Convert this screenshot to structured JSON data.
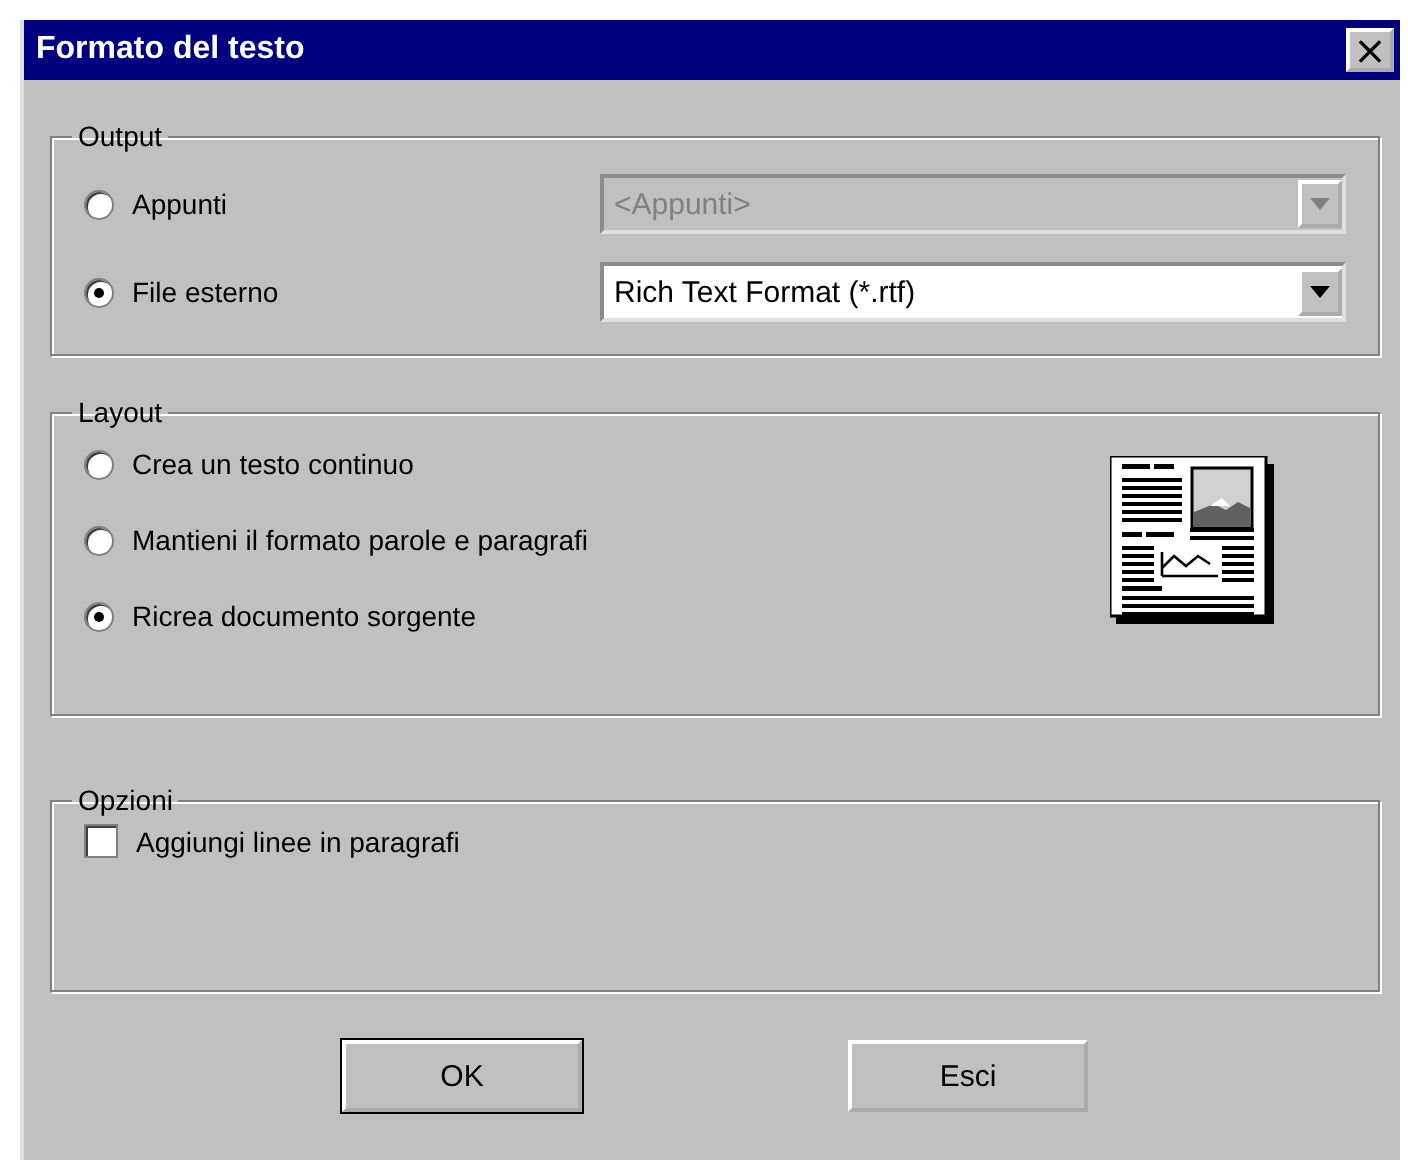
{
  "window": {
    "title": "Formato del testo",
    "close": "×"
  },
  "output": {
    "title": "Output",
    "options": [
      {
        "label": "Appunti",
        "selected": false,
        "dropdown": {
          "value": "<Appunti>",
          "disabled": true
        }
      },
      {
        "label": "File esterno",
        "selected": true,
        "dropdown": {
          "value": "Rich Text Format (*.rtf)",
          "disabled": false
        }
      }
    ]
  },
  "layout": {
    "title": "Layout",
    "options": [
      {
        "label": "Crea un testo continuo",
        "selected": false
      },
      {
        "label": "Mantieni il formato parole e paragrafi",
        "selected": false
      },
      {
        "label": "Ricrea documento sorgente",
        "selected": true
      }
    ]
  },
  "options": {
    "title": "Opzioni",
    "checkboxes": [
      {
        "label": "Aggiungi linee in paragrafi",
        "checked": false
      }
    ]
  },
  "buttons": [
    {
      "label": "OK",
      "default": true
    },
    {
      "label": "Esci",
      "default": false
    }
  ]
}
